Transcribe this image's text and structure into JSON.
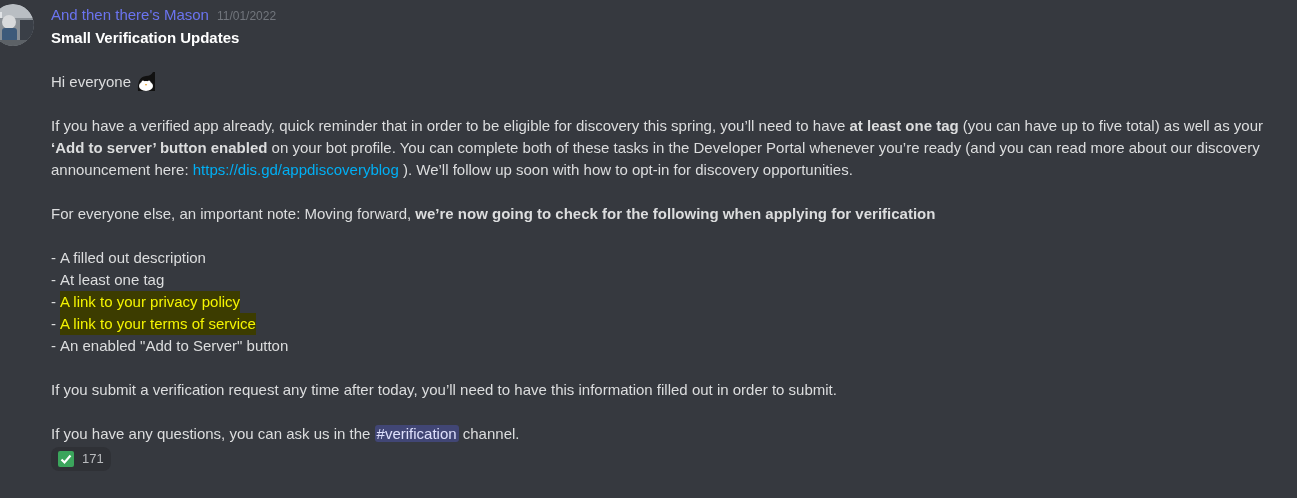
{
  "message": {
    "author": "And then there's Mason",
    "timestamp": "11/01/2022",
    "title": "Small Verification Updates",
    "greeting": "Hi everyone",
    "paragraph_1": [
      {
        "kind": "text",
        "text": "If you have a verified app already, quick reminder that in order to be eligible for discovery this spring, you’ll need to have **at least one tag** (you can have up to five total) as well as your **‘Add to server’ button enabled** on your bot profile. You can complete both of these tasks in the Developer Portal whenever you’re ready (and you can read more about our discovery announcement here: "
      },
      {
        "kind": "link",
        "text": "https://dis.gd/appdiscoveryblog"
      },
      {
        "kind": "text",
        "text": " ). We’ll follow up soon with how to opt-in for discovery opportunities."
      }
    ],
    "paragraph_2": "For everyone else, an important note: Moving forward, **we’re now going to check for the following when applying for verification**",
    "checklist": [
      {
        "bullet": "-",
        "text": "A filled out description",
        "highlighted": false
      },
      {
        "bullet": "-",
        "text": "At least one tag",
        "highlighted": false
      },
      {
        "bullet": "-",
        "text": "A link to your privacy policy",
        "highlighted": true
      },
      {
        "bullet": "-",
        "text": "A link to your terms of service",
        "highlighted": true
      },
      {
        "bullet": "-",
        "text": "An enabled \"Add to Server\" button",
        "highlighted": false
      }
    ],
    "paragraph_3": "If you submit a verification request any time after today, you’ll need to have this information filled out in order to submit.",
    "paragraph_4": [
      {
        "kind": "text",
        "text": "If you have any questions, you can ask us in the "
      },
      {
        "kind": "channel",
        "text": "#verification"
      },
      {
        "kind": "text",
        "text": " channel."
      }
    ],
    "reactions": [
      {
        "count": "171",
        "selected": false
      }
    ]
  }
}
